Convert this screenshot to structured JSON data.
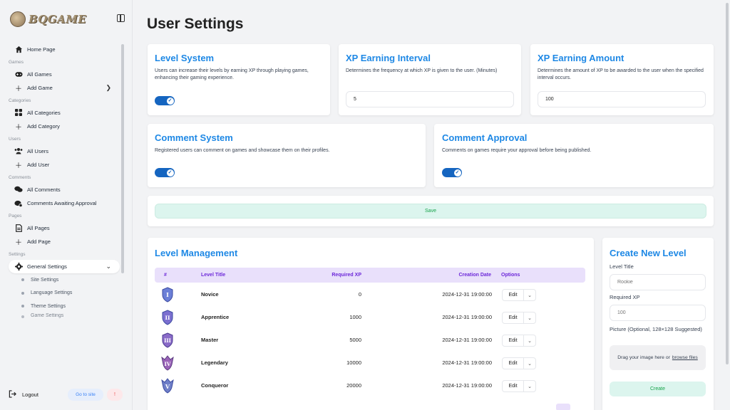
{
  "brand": {
    "name": "BQGAME"
  },
  "sidebar": {
    "home": "Home Page",
    "sections": {
      "games": "Games",
      "categories": "Categories",
      "users": "Users",
      "comments": "Comments",
      "pages": "Pages",
      "settings": "Settings"
    },
    "items": {
      "all_games": "All Games",
      "add_game": "Add Game",
      "all_categories": "All Categories",
      "add_category": "Add Category",
      "all_users": "All Users",
      "add_user": "Add User",
      "all_comments": "All Comments",
      "comments_awaiting": "Comments Awaiting Approval",
      "all_pages": "All Pages",
      "add_page": "Add Page",
      "general_settings": "General Settings"
    },
    "sub_items": [
      "Site Settings",
      "Language Settings",
      "Theme Settings",
      "Game Settings"
    ],
    "logout": "Logout",
    "goto_site": "Go to site",
    "alert": "!"
  },
  "main": {
    "title": "User Settings",
    "level_system": {
      "title": "Level System",
      "desc": "Users can increase their levels by earning XP through playing games, enhancing their gaming experience.",
      "enabled": true
    },
    "xp_interval": {
      "title": "XP Earning Interval",
      "desc": "Determines the frequency at which XP is given to the user. (Minutes)",
      "value": "5"
    },
    "xp_amount": {
      "title": "XP Earning Amount",
      "desc": "Determines the amount of XP to be awarded to the user when the specified interval occurs.",
      "value": "100"
    },
    "comment_system": {
      "title": "Comment System",
      "desc": "Registered users can comment on games and showcase them on their profiles.",
      "enabled": true
    },
    "comment_approval": {
      "title": "Comment Approval",
      "desc": "Comments on games require your approval before being published.",
      "enabled": true
    },
    "save_label": "Save"
  },
  "levels": {
    "title": "Level Management",
    "columns": [
      "#",
      "Level Title",
      "Required XP",
      "Creation Date",
      "Options"
    ],
    "rows": [
      {
        "numeral": "I",
        "title": "Novice",
        "xp": "0",
        "date": "2024-12-31 19:00:00",
        "edit": "Edit",
        "color": "#6b7fd7"
      },
      {
        "numeral": "II",
        "title": "Apprentice",
        "xp": "1000",
        "date": "2024-12-31 19:00:00",
        "edit": "Edit",
        "color": "#7b6fd0"
      },
      {
        "numeral": "III",
        "title": "Master",
        "xp": "5000",
        "date": "2024-12-31 19:00:00",
        "edit": "Edit",
        "color": "#8a6bc8"
      },
      {
        "numeral": "IV",
        "title": "Legendary",
        "xp": "10000",
        "date": "2024-12-31 19:00:00",
        "edit": "Edit",
        "color": "#9a63b8"
      },
      {
        "numeral": "V",
        "title": "Conqueror",
        "xp": "20000",
        "date": "2024-12-31 19:00:00",
        "edit": "Edit",
        "color": "#6f7fc8"
      }
    ]
  },
  "create_level": {
    "title": "Create New Level",
    "level_title_label": "Level Title",
    "level_title_placeholder": "Rookie",
    "required_xp_label": "Required XP",
    "required_xp_placeholder": "100",
    "picture_label": "Picture (Optional, 128×128 Suggested)",
    "dropzone_text": "Drag your image here or",
    "browse_text": "browse files",
    "create_label": "Create"
  }
}
